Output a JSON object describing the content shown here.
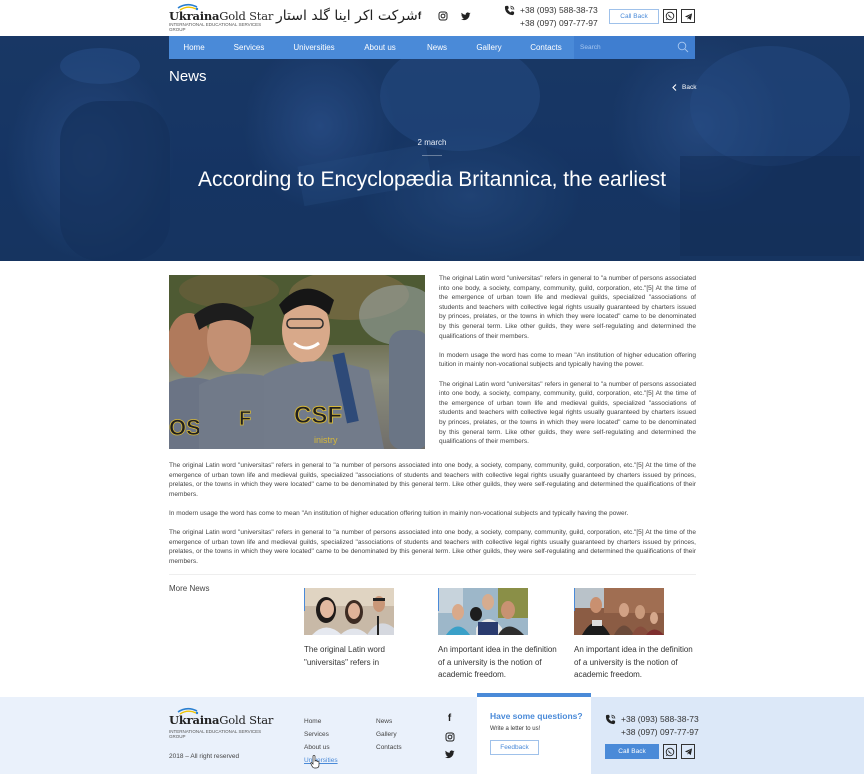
{
  "header": {
    "logo": {
      "brand_bold": "Ukraina",
      "brand_regular": "Gold",
      "brand_light": "Star",
      "tagline": "International Educational Services Group"
    },
    "persian_name": "شرکت اکر اینا گلد استار",
    "social": [
      {
        "icon": "facebook-icon",
        "glyph": "f"
      },
      {
        "icon": "instagram-icon",
        "glyph": "◎"
      },
      {
        "icon": "twitter-icon",
        "glyph": "🐦"
      }
    ],
    "phones": [
      "+38 (093) 588-38-73",
      "+38 (097) 097-77-97"
    ],
    "callback_label": "Call Back"
  },
  "nav": {
    "items": [
      {
        "label": "Home"
      },
      {
        "label": "Services"
      },
      {
        "label": "Universities"
      },
      {
        "label": "About us"
      },
      {
        "label": "News"
      },
      {
        "label": "Gallery"
      },
      {
        "label": "Contacts"
      }
    ],
    "search_placeholder": "Search"
  },
  "hero": {
    "section_title": "News",
    "back_label": "Back",
    "date": "2 march",
    "headline": "According to Encyclopædia Britannica, the earliest"
  },
  "article": {
    "right_paragraphs": [
      "The original Latin word \"universitas\" refers in general to \"a number of persons associated into one body, a society, company, community, guild, corporation, etc.\"[5] At the time of the emergence of urban town life and medieval guilds, specialized \"associations of students and teachers with collective legal rights usually guaranteed by charters issued by princes, prelates, or the towns in which they were located\" came to be denominated by this general term. Like other guilds, they were self-regulating and determined the qualifications of their members.",
      "In modern usage the word has come to mean \"An institution of higher education offering tuition in mainly non-vocational subjects and typically having the power.",
      "The original Latin word \"universitas\" refers in general to \"a number of persons associated into one body, a society, company, community, guild, corporation, etc.\"[5] At the time of the emergence of urban town life and medieval guilds, specialized \"associations of students and teachers with collective legal rights usually guaranteed by charters issued by princes, prelates, or the towns in which they were located\" came to be denominated by this general term. Like other guilds, they were self-regulating and determined the qualifications of their members."
    ],
    "full_paragraphs": [
      "The original Latin word \"universitas\" refers in general to \"a number of persons associated into one body, a society, company, community, guild, corporation, etc.\"[5] At the time of the emergence of urban town life and medieval guilds, specialized \"associations of students and teachers with collective legal rights usually guaranteed by charters issued by princes, prelates, or the towns in which they were located\" came to be denominated by this general term. Like other guilds, they were self-regulating and determined the qualifications of their members.",
      "In modern usage the word has come to mean \"An institution of higher education offering tuition in mainly non-vocational subjects and typically having the power.",
      "The original Latin word \"universitas\" refers in general to \"a number of persons associated into one body, a society, company, community, guild, corporation, etc.\"[5] At the time of the emergence of urban town life and medieval guilds, specialized \"associations of students and teachers with collective legal rights usually guaranteed by charters issued by princes, prelates, or the towns in which they were located\" came to be denominated by this general term. Like other guilds, they were self-regulating and determined the qualifications of their members."
    ]
  },
  "more_news": {
    "label": "More News",
    "cards": [
      {
        "caption": "The original Latin word \"universitas\" refers in"
      },
      {
        "caption": "An important idea in the definition of a university is the notion of academic freedom."
      },
      {
        "caption": "An important idea in the definition of a university is the notion of academic freedom."
      }
    ]
  },
  "footer": {
    "copyright": "2018 – All right reserved",
    "links_col1": [
      "Home",
      "Services",
      "About us",
      "Universities"
    ],
    "links_col2": [
      "News",
      "Gallery",
      "Contacts"
    ],
    "question_title": "Have some questions?",
    "question_sub": "Write a letter to us!",
    "feedback_label": "Feedback",
    "phones": [
      "+38 (093) 588-38-73",
      "+38 (097) 097-77-97"
    ],
    "callback_label": "Call Back"
  },
  "colors": {
    "accent": "#4a8ad8",
    "hero_overlay": "#163563",
    "footer_bg": "#eaf1fb"
  }
}
